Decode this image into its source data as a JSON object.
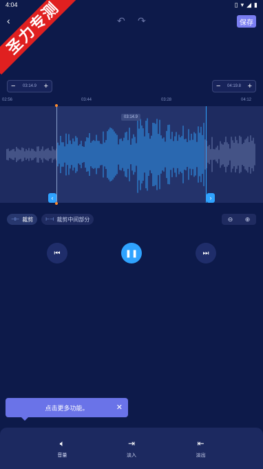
{
  "status_bar": {
    "time": "4:04",
    "icons": [
      "vibrate-icon",
      "wifi-icon",
      "signal-icon",
      "battery-icon"
    ]
  },
  "watermark": {
    "text": "圣力专测"
  },
  "toolbar": {
    "save_label": "保存"
  },
  "range": {
    "start_time": "03:14.9",
    "end_time": "04:19.8",
    "minus": "−",
    "plus": "+"
  },
  "timeline": {
    "ticks": [
      "02:56",
      "03:44",
      "03:28",
      "04:12"
    ],
    "current_time": "03:14.9"
  },
  "modes": {
    "trim_label": "裁剪",
    "delete_middle_label": "裁剪中间部分"
  },
  "tip": {
    "text": "点击更多功能。"
  },
  "tools": [
    {
      "label": "音量",
      "icon": "volume-icon"
    },
    {
      "label": "淡入",
      "icon": "fade-in-icon"
    },
    {
      "label": "淡出",
      "icon": "fade-out-icon"
    }
  ],
  "colors": {
    "background": "#0d1a4a",
    "accent": "#2fa3ff",
    "save": "#7a7ef2",
    "selection": "#24336b"
  }
}
